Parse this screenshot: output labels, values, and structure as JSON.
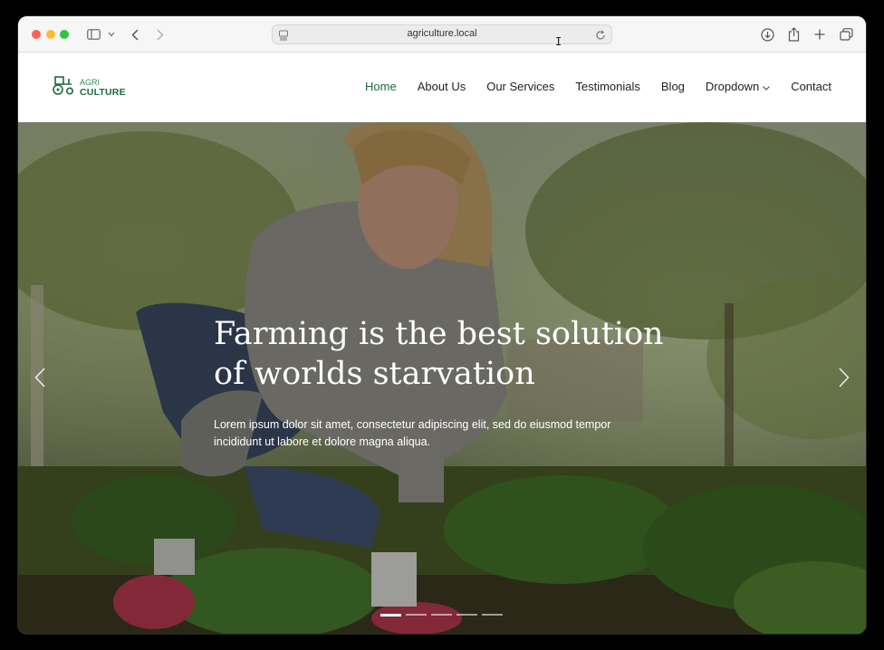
{
  "browser": {
    "url": "agriculture.local",
    "icons": [
      "sidebar-icon",
      "chevron-down-icon",
      "back-icon",
      "forward-icon",
      "reader-icon",
      "reload-icon",
      "download-icon",
      "share-icon",
      "plus-icon",
      "tabs-icon"
    ]
  },
  "site": {
    "logo": {
      "line1": "AGRI",
      "line2": "CULTURE",
      "icon": "tractor-icon"
    },
    "nav": [
      {
        "label": "Home",
        "active": true
      },
      {
        "label": "About Us",
        "active": false
      },
      {
        "label": "Our Services",
        "active": false
      },
      {
        "label": "Testimonials",
        "active": false
      },
      {
        "label": "Blog",
        "active": false
      },
      {
        "label": "Dropdown",
        "active": false
      },
      {
        "label": "Contact",
        "active": false
      }
    ],
    "colors": {
      "brand": "#1b6b3c",
      "accent": "#2f8a4d"
    }
  },
  "hero": {
    "title_line1": "Farming is the best solution",
    "title_line2": "of worlds starvation",
    "text_line1": "Lorem ipsum dolor sit amet, consectetur adipiscing elit, sed do eiusmod tempor",
    "text_line2": "incididunt ut labore et dolore magna aliqua.",
    "slides": 5,
    "active_slide": 1,
    "icons": [
      "chevron-left-icon",
      "chevron-right-icon"
    ]
  }
}
